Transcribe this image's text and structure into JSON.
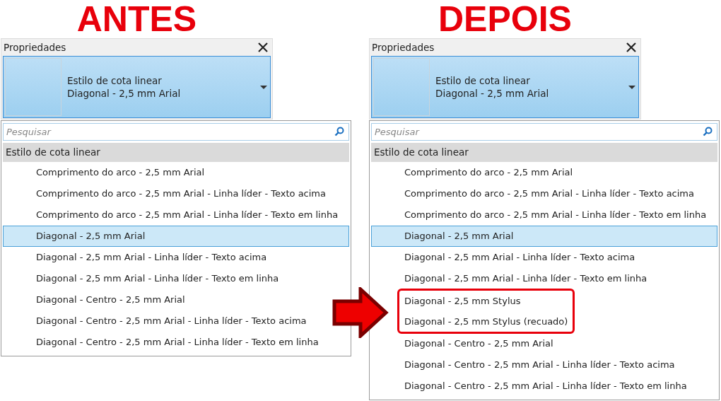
{
  "panels": [
    {
      "heading": "ANTES",
      "title": "Propriedades",
      "type_selector": {
        "line_1": "Estilo de cota linear",
        "line_2": "Diagonal - 2,5 mm Arial"
      },
      "search": {
        "placeholder": "Pesquisar"
      },
      "group": "Estilo de cota linear",
      "items": [
        {
          "kind": "item",
          "label": "Comprimento do arco - 2,5 mm Arial",
          "selected": false
        },
        {
          "kind": "item",
          "label": "Comprimento do arco - 2,5 mm Arial - Linha líder - Texto acima",
          "selected": false
        },
        {
          "kind": "item",
          "label": "Comprimento do arco - 2,5 mm Arial - Linha líder - Texto em linha",
          "selected": false
        },
        {
          "kind": "item",
          "label": "Diagonal - 2,5 mm Arial",
          "selected": true
        },
        {
          "kind": "item",
          "label": "Diagonal - 2,5 mm Arial - Linha líder - Texto acima",
          "selected": false
        },
        {
          "kind": "item",
          "label": "Diagonal - 2,5 mm Arial - Linha líder - Texto em linha",
          "selected": false
        },
        {
          "kind": "item",
          "label": "Diagonal - Centro - 2,5 mm Arial",
          "selected": false
        },
        {
          "kind": "item",
          "label": "Diagonal - Centro - 2,5 mm Arial - Linha líder - Texto acima",
          "selected": false
        },
        {
          "kind": "item",
          "label": "Diagonal - Centro - 2,5 mm Arial - Linha líder - Texto em linha",
          "selected": false
        }
      ]
    },
    {
      "heading": "DEPOIS",
      "title": "Propriedades",
      "type_selector": {
        "line_1": "Estilo de cota linear",
        "line_2": "Diagonal - 2,5 mm Arial"
      },
      "search": {
        "placeholder": "Pesquisar"
      },
      "group": "Estilo de cota linear",
      "items": [
        {
          "kind": "item",
          "label": "Comprimento do arco - 2,5 mm Arial",
          "selected": false
        },
        {
          "kind": "item",
          "label": "Comprimento do arco - 2,5 mm Arial - Linha líder - Texto acima",
          "selected": false
        },
        {
          "kind": "item",
          "label": "Comprimento do arco - 2,5 mm Arial - Linha líder - Texto em linha",
          "selected": false
        },
        {
          "kind": "item",
          "label": "Diagonal - 2,5 mm Arial",
          "selected": true
        },
        {
          "kind": "item",
          "label": "Diagonal - 2,5 mm Arial - Linha líder - Texto acima",
          "selected": false
        },
        {
          "kind": "item",
          "label": "Diagonal - 2,5 mm Arial - Linha líder - Texto em linha",
          "selected": false
        },
        {
          "kind": "highlight",
          "items": [
            {
              "label": "Diagonal - 2,5 mm Stylus",
              "selected": false
            },
            {
              "label": "Diagonal - 2,5 mm Stylus (recuado)",
              "selected": false
            }
          ]
        },
        {
          "kind": "item",
          "label": "Diagonal - Centro - 2,5 mm Arial",
          "selected": false
        },
        {
          "kind": "item",
          "label": "Diagonal - Centro - 2,5 mm Arial - Linha líder - Texto acima",
          "selected": false
        },
        {
          "kind": "item",
          "label": "Diagonal - Centro - 2,5 mm Arial - Linha líder - Texto em linha",
          "selected": false
        }
      ]
    }
  ]
}
